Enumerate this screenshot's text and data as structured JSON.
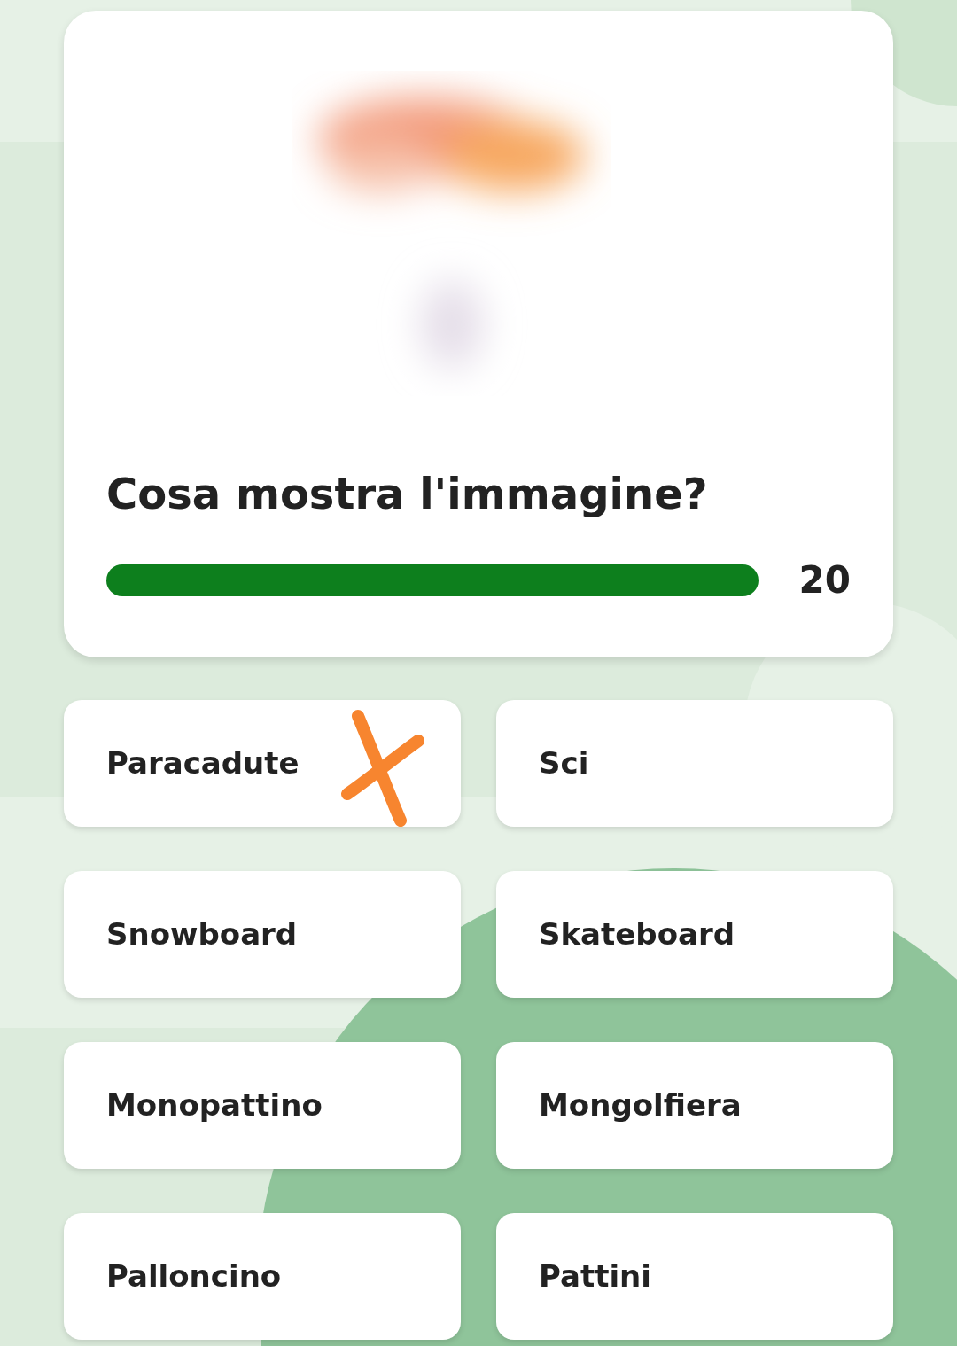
{
  "question": {
    "text": "Cosa mostra l'immagine?",
    "timer": {
      "reading": "20"
    }
  },
  "answers": [
    {
      "label": "Paracadute",
      "marked": true
    },
    {
      "label": "Sci",
      "marked": false
    },
    {
      "label": "Snowboard",
      "marked": false
    },
    {
      "label": "Skateboard",
      "marked": false
    },
    {
      "label": "Monopattino",
      "marked": false
    },
    {
      "label": "Mongolfiera",
      "marked": false
    },
    {
      "label": "Palloncino",
      "marked": false
    },
    {
      "label": "Pattini",
      "marked": false
    }
  ]
}
